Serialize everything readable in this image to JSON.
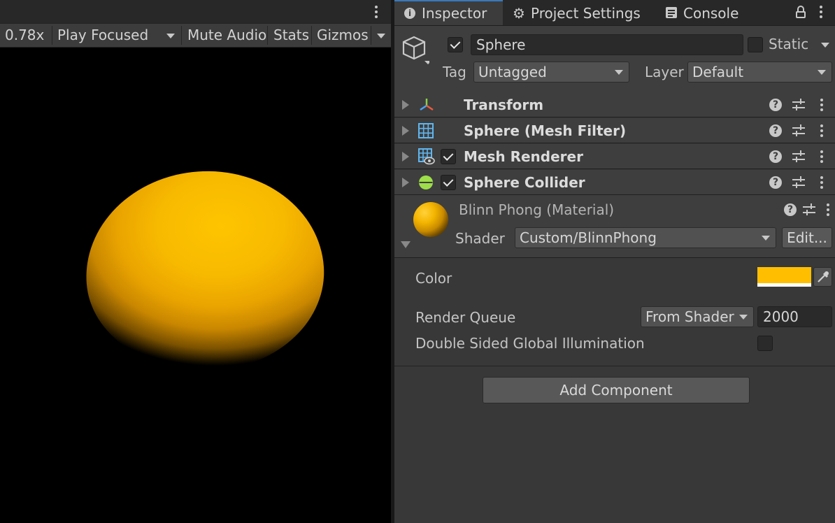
{
  "game_view": {
    "scale_value": "0.78x",
    "play_mode_label": "Play Focused",
    "mute_audio_label": "Mute Audio",
    "stats_label": "Stats",
    "gizmos_label": "Gizmos"
  },
  "tabs": [
    {
      "label": "Inspector",
      "icon": "info-icon",
      "active": true
    },
    {
      "label": "Project Settings",
      "icon": "gear-icon",
      "active": false
    },
    {
      "label": "Console",
      "icon": "console-icon",
      "active": false
    }
  ],
  "gameobject": {
    "name": "Sphere",
    "active": true,
    "static_label": "Static",
    "static_checked": false,
    "tag_label": "Tag",
    "tag_value": "Untagged",
    "layer_label": "Layer",
    "layer_value": "Default"
  },
  "components": [
    {
      "name": "Transform",
      "icon": "transform-icon",
      "has_toggle": false
    },
    {
      "name": "Sphere (Mesh Filter)",
      "icon": "mesh-filter-icon",
      "has_toggle": false
    },
    {
      "name": "Mesh Renderer",
      "icon": "mesh-renderer-icon",
      "has_toggle": true,
      "enabled": true
    },
    {
      "name": "Sphere Collider",
      "icon": "sphere-collider-icon",
      "has_toggle": true,
      "enabled": true
    }
  ],
  "material": {
    "title": "Blinn Phong (Material)",
    "shader_label": "Shader",
    "shader_value": "Custom/BlinnPhong",
    "edit_label": "Edit...",
    "color_label": "Color",
    "color_value": "#FFBF00",
    "render_queue_label": "Render Queue",
    "render_queue_mode": "From Shader",
    "render_queue_value": "2000",
    "double_sided_gi_label": "Double Sided Global Illumination",
    "double_sided_gi_checked": false
  },
  "add_component_label": "Add Component",
  "colors": {
    "accent": "#3A79BB",
    "sphere": "#FEC400",
    "panel_bg": "#383838",
    "header_bg": "#3E3E3E"
  }
}
